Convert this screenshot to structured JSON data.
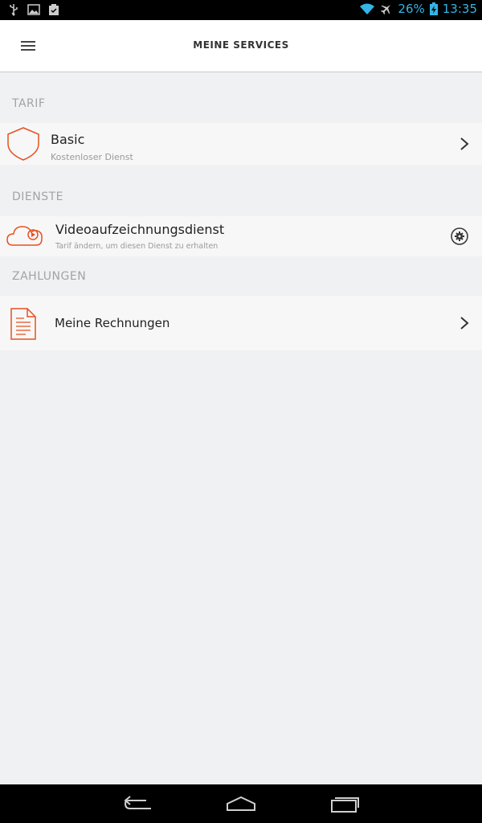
{
  "status_bar": {
    "battery": "26%",
    "time": "13:35",
    "left_icons": [
      "usb-icon",
      "image-icon",
      "clipboard-icon"
    ],
    "right_icons": [
      "wifi-icon",
      "airplane-icon",
      "battery-charging-icon"
    ]
  },
  "app_bar": {
    "title": "MEINE SERVICES",
    "menu_icon": "hamburger-menu-icon"
  },
  "sections": {
    "tarif": {
      "header": "TARIF",
      "item": {
        "title": "Basic",
        "subtitle": "Kostenloser Dienst",
        "icon": "shield-icon"
      }
    },
    "dienste": {
      "header": "DIENSTE",
      "item": {
        "title": "Videoaufzeichnungsdienst",
        "subtitle": "Tarif ändern, um diesen Dienst zu erhalten",
        "icon": "cloud-video-icon",
        "action_icon": "settings-gear-icon"
      }
    },
    "zahlungen": {
      "header": "ZAHLUNGEN",
      "item": {
        "title": "Meine Rechnungen",
        "icon": "invoice-document-icon"
      }
    }
  },
  "nav_bar": {
    "buttons": [
      "back-icon",
      "home-icon",
      "recent-apps-icon"
    ]
  },
  "colors": {
    "accent": "#e8501e",
    "status_text": "#33b5e5",
    "background": "#f0f1f2",
    "row_background": "#f7f7f8"
  }
}
